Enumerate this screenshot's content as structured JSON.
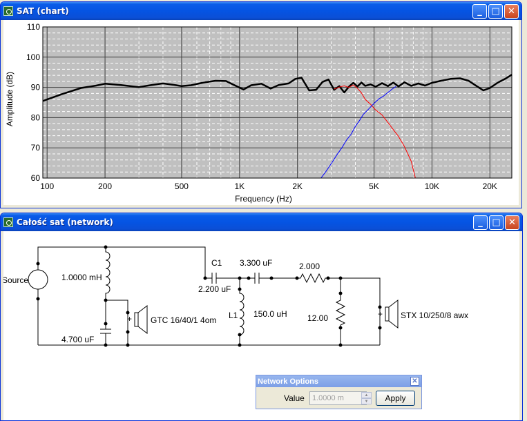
{
  "chart_window": {
    "title": "SAT (chart)",
    "buttons": {
      "minimize": "_",
      "maximize": "□",
      "close": "✕"
    }
  },
  "chart_data": {
    "type": "line",
    "title": "",
    "xlabel": "Frequency (Hz)",
    "ylabel": "Amplitude (dB)",
    "xscale": "log",
    "xlim": [
      95,
      26000
    ],
    "ylim": [
      60,
      110
    ],
    "grid": true,
    "background": "#c0c0c0",
    "yticks": [
      "110",
      "100",
      "90",
      "80",
      "70",
      "60"
    ],
    "ytick_values": [
      110,
      100,
      90,
      80,
      70,
      60
    ],
    "xticks": [
      "100",
      "200",
      "500",
      "1K",
      "2K",
      "5K",
      "10K",
      "20K"
    ],
    "xtick_values": [
      100,
      200,
      500,
      1000,
      2000,
      5000,
      10000,
      20000
    ],
    "series": [
      {
        "color": "#000000",
        "x": [
          95,
          120,
          150,
          180,
          200,
          240,
          300,
          350,
          400,
          450,
          500,
          560,
          650,
          750,
          850,
          950,
          1050,
          1150,
          1300,
          1450,
          1600,
          1800,
          1950,
          2100,
          2300,
          2500,
          2700,
          2900,
          3100,
          3300,
          3500,
          3700,
          3900,
          4100,
          4300,
          4500,
          4800,
          5100,
          5500,
          5900,
          6300,
          6700,
          7200,
          7800,
          8500,
          9200,
          10000,
          11000,
          12500,
          14000,
          15500,
          17000,
          18500,
          20000,
          22000,
          24000,
          26000
        ],
        "values": [
          85.5,
          87.8,
          89.8,
          90.6,
          91.2,
          90.8,
          90.1,
          90.8,
          91.3,
          90.9,
          90.4,
          90.7,
          91.6,
          92.2,
          92.1,
          90.6,
          89.3,
          90.7,
          91.2,
          89.6,
          90.8,
          91.3,
          92.8,
          93.2,
          89.0,
          89.2,
          91.8,
          92.6,
          89.2,
          90.4,
          88.3,
          90.2,
          91.5,
          90.3,
          91.6,
          90.5,
          91.0,
          90.2,
          91.4,
          90.4,
          91.6,
          90.3,
          91.7,
          90.5,
          91.3,
          90.6,
          91.5,
          92.1,
          92.8,
          93.0,
          92.2,
          90.5,
          89.0,
          89.8,
          91.6,
          92.8,
          94.2
        ]
      },
      {
        "color": "#ff0000",
        "x": [
          3100,
          3300,
          3500,
          3700,
          3900,
          4100,
          4300,
          4500,
          4800,
          5100,
          5500,
          5900,
          6300,
          6700,
          7200,
          7800,
          8200
        ],
        "values": [
          89.4,
          90.1,
          90.5,
          90.0,
          90.8,
          89.7,
          88.2,
          86.0,
          84.4,
          82.5,
          80.9,
          78.4,
          76.0,
          73.8,
          70.4,
          65.6,
          60.0
        ]
      },
      {
        "color": "#0000ff",
        "x": [
          2650,
          2800,
          3000,
          3200,
          3400,
          3600,
          3800,
          4000,
          4200,
          4400,
          4700,
          5000,
          5300,
          5600,
          5900,
          6200,
          6500
        ],
        "values": [
          60.0,
          62.0,
          64.8,
          67.6,
          70.0,
          72.6,
          74.5,
          77.1,
          79.0,
          81.1,
          82.9,
          84.7,
          86.2,
          87.1,
          88.3,
          89.4,
          90.3
        ]
      }
    ]
  },
  "network_window": {
    "title": "Całość sat (network)",
    "buttons": {
      "minimize": "_",
      "maximize": "□",
      "close": "✕"
    },
    "labels": {
      "source": "Source",
      "inductor1": "1.0000 mH",
      "cap1": "4.700 uF",
      "driver1": "GTC 16/40/1 4om",
      "c1_name": "C1",
      "c1_value": "2.200 uF",
      "cap3": "3.300 uF",
      "l1_name": "L1",
      "l1_value": "150.0 uH",
      "res1": "2.000",
      "res2": "12.00",
      "driver2": "STX 10/250/8 awx",
      "plus1": "+",
      "plus2": "+"
    }
  },
  "network_options": {
    "title": "Network Options",
    "close": "✕",
    "value_label": "Value",
    "value": "1.0000 m",
    "apply_label": "Apply"
  }
}
